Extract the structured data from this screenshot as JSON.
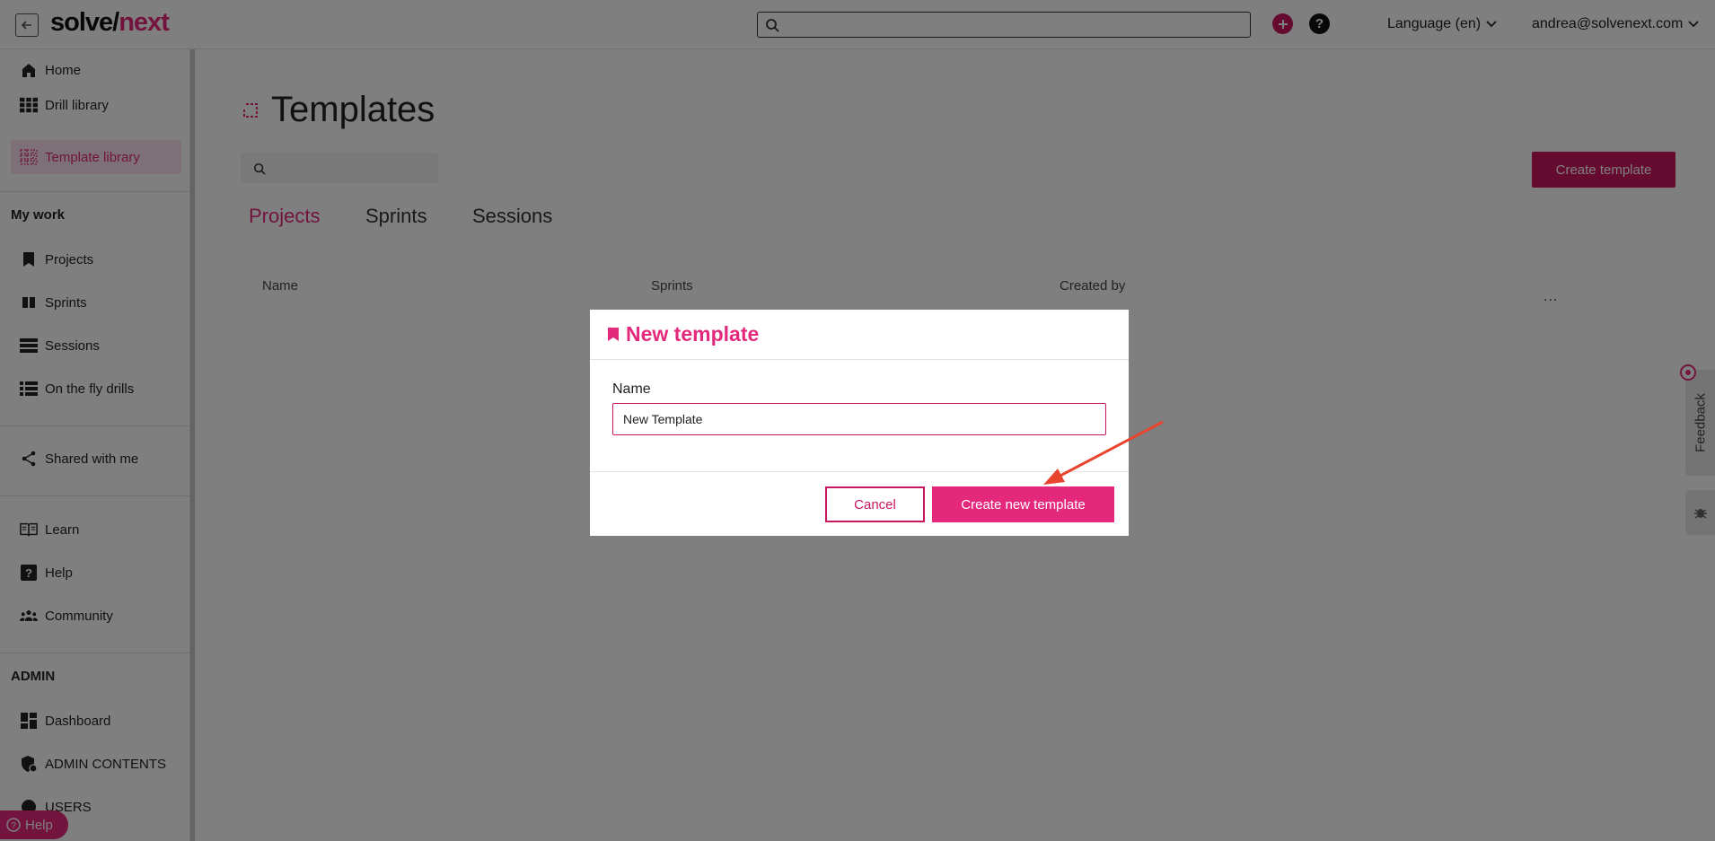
{
  "header": {
    "logo_part1": "solve/",
    "logo_part2": "next",
    "search_placeholder": "",
    "language": "Language (en)",
    "user_email": "andrea@solvenext.com"
  },
  "sidebar": {
    "top_items": [
      {
        "label": "Home",
        "icon": "home-icon"
      },
      {
        "label": "Drill library",
        "icon": "grid-icon"
      },
      {
        "label": "Template library",
        "icon": "dotted-grid-icon"
      }
    ],
    "my_work_heading": "My work",
    "work_items": [
      {
        "label": "Projects",
        "icon": "bookmark-icon"
      },
      {
        "label": "Sprints",
        "icon": "columns-icon"
      },
      {
        "label": "Sessions",
        "icon": "rows-icon"
      },
      {
        "label": "On the fly drills",
        "icon": "list-icon"
      }
    ],
    "shared_label": "Shared with me",
    "resource_items": [
      {
        "label": "Learn",
        "icon": "book-icon"
      },
      {
        "label": "Help",
        "icon": "question-icon"
      },
      {
        "label": "Community",
        "icon": "people-icon"
      }
    ],
    "admin_heading": "ADMIN",
    "admin_items": [
      {
        "label": "Dashboard",
        "icon": "dashboard-icon"
      },
      {
        "label": "ADMIN CONTENTS",
        "icon": "shield-icon"
      },
      {
        "label": "USERS",
        "icon": "user-icon"
      }
    ],
    "help_pill": "Help"
  },
  "main": {
    "title": "Templates",
    "create_button": "Create template",
    "tabs": [
      "Projects",
      "Sprints",
      "Sessions"
    ],
    "columns": [
      "Name",
      "Sprints",
      "Created by"
    ],
    "more": "..."
  },
  "feedback": {
    "label": "Feedback"
  },
  "modal": {
    "title": "New template",
    "name_label": "Name",
    "name_value": "New Template",
    "cancel": "Cancel",
    "confirm": "Create new template"
  },
  "colors": {
    "brand": "#e4287c",
    "brand_dark": "#c8175f",
    "annotation_arrow": "#e8442e"
  }
}
